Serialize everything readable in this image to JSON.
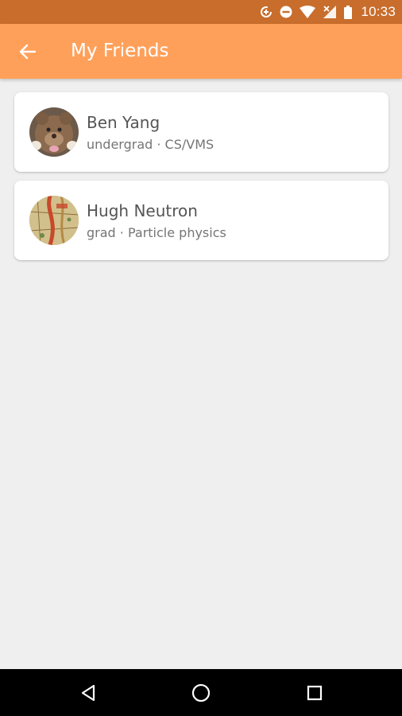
{
  "status_bar": {
    "time": "10:33",
    "icons": [
      "data-saver-icon",
      "do-not-disturb-icon",
      "wifi-icon",
      "no-signal-icon",
      "battery-icon"
    ]
  },
  "app_bar": {
    "title": "My Friends",
    "back_icon": "arrow-left-icon",
    "background": "#ffa05a"
  },
  "colors": {
    "status_bar": "#c86d2c",
    "app_bar": "#ffa05a",
    "page_background": "#efefef",
    "card": "#ffffff"
  },
  "friends": [
    {
      "name": "Ben Yang",
      "subtitle": "undergrad · CS/VMS",
      "avatar": "teddy-bear-photo"
    },
    {
      "name": "Hugh Neutron",
      "subtitle": "grad · Particle physics",
      "avatar": "map-illustration"
    }
  ],
  "nav_bar": {
    "buttons": [
      "back-triangle-icon",
      "home-circle-icon",
      "recents-square-icon"
    ]
  }
}
